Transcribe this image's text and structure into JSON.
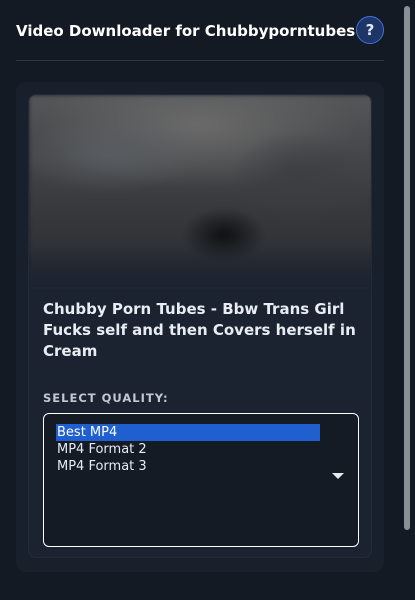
{
  "header": {
    "title": "Video Downloader for Chubbyporntubes",
    "help_label": "?"
  },
  "video": {
    "title": "Chubby Porn Tubes - Bbw Trans Girl Fucks self and then Covers herself in Cream"
  },
  "quality": {
    "label": "SELECT QUALITY:",
    "options": [
      "Best MP4",
      "MP4 Format 2",
      "MP4 Format 3"
    ],
    "selected": "Best MP4"
  },
  "icons": {
    "help": "question-mark-icon",
    "dropdown": "chevron-down-icon"
  },
  "colors": {
    "background": "#141a23",
    "selected_option": "#1f5fd0",
    "help_accent": "#3f73e0"
  }
}
